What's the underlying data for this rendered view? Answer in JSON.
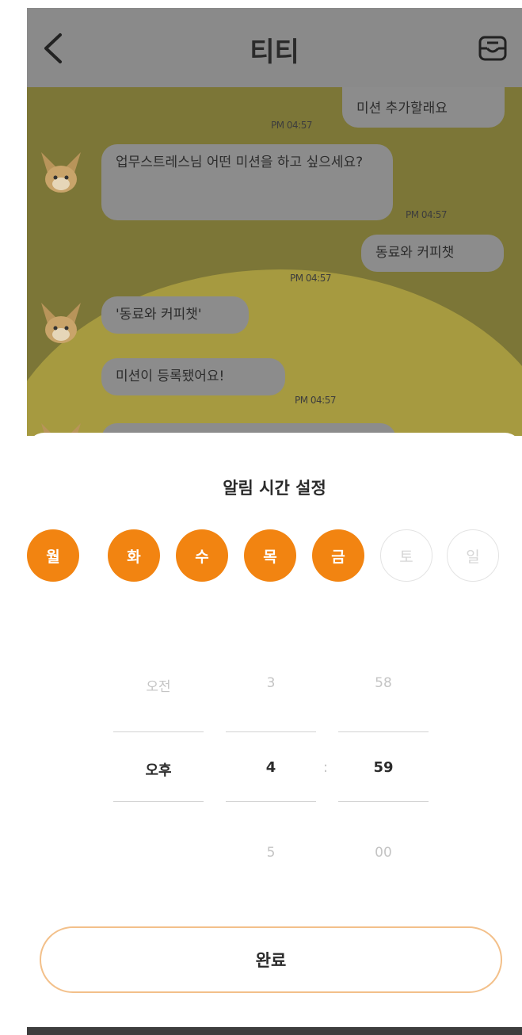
{
  "header": {
    "title": "티티"
  },
  "chat": {
    "messages": [
      {
        "text": "미션 추가할래요",
        "time": "PM 04:57"
      },
      {
        "text": "업무스트레스님 어떤 미션을 하고 싶으세요?",
        "time": "PM 04:57"
      },
      {
        "text": "동료와 커피챗",
        "time": "PM 04:57"
      },
      {
        "text": "'동료와 커피챗'"
      },
      {
        "text": "미션이 등록됐어요!",
        "time": "PM 04:57"
      }
    ]
  },
  "sheet": {
    "title": "알림 시간 설정",
    "days": [
      "월",
      "화",
      "수",
      "목",
      "금",
      "토",
      "일"
    ],
    "days_selected": [
      true,
      true,
      true,
      true,
      true,
      false,
      false
    ],
    "picker": {
      "ampm": {
        "above": "오전",
        "selected": "오후",
        "below": ""
      },
      "hour": {
        "above": "3",
        "selected": "4",
        "below": "5"
      },
      "separator": ":",
      "minute": {
        "above": "58",
        "selected": "59",
        "below": "00"
      }
    },
    "done_label": "완료"
  },
  "colors": {
    "accent": "#f28411",
    "accent_outline": "#f3c08a",
    "chat_bg": "#7c7637"
  }
}
